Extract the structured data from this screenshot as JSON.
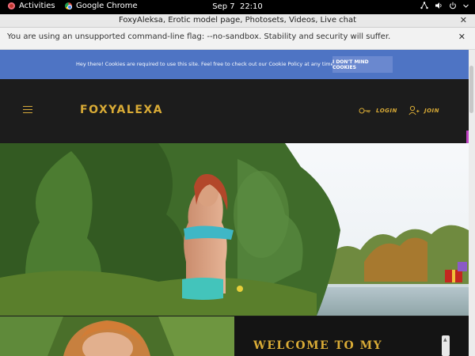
{
  "system_bar": {
    "activities": "Activities",
    "app_name": "Google Chrome",
    "date": "Sep 7",
    "time": "22:10"
  },
  "window": {
    "title": "FoxyAleksa, Erotic model page, Photosets, Videos, Live chat"
  },
  "infobar": {
    "message": "You are using an unsupported command-line flag: --no-sandbox. Stability and security will suffer."
  },
  "cookie_banner": {
    "message": "Hey there! Cookies are required to use this site. Feel free to check out our Cookie Policy at any time.",
    "button": "I DON'T MIND COOKIES"
  },
  "header": {
    "logo": "FOXYALEXA",
    "login": "LOGIN",
    "join": "JOIN"
  },
  "welcome": {
    "heading": "WELCOME TO MY"
  },
  "colors": {
    "accent_gold": "#d9ab36",
    "cookie_blue": "#4e74c4",
    "header_bg": "#1c1c1c"
  }
}
